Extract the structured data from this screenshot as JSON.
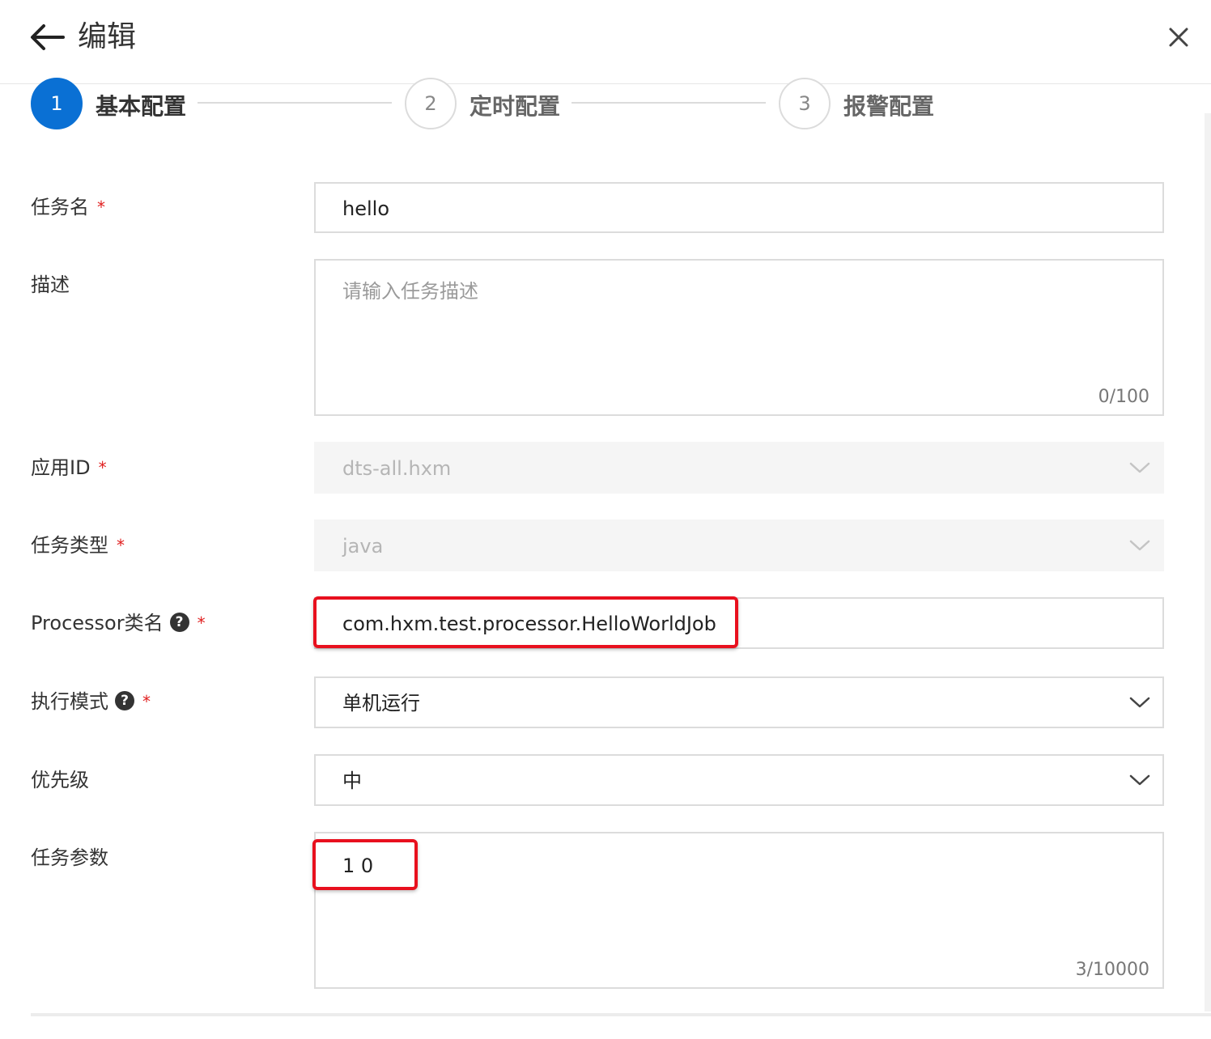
{
  "header": {
    "title": "编辑",
    "back_icon": "arrow-left-icon",
    "close_icon": "close-icon"
  },
  "steps": [
    {
      "number": "1",
      "label": "基本配置",
      "state": "active"
    },
    {
      "number": "2",
      "label": "定时配置",
      "state": "pending"
    },
    {
      "number": "3",
      "label": "报警配置",
      "state": "pending"
    }
  ],
  "form": {
    "task_name": {
      "label": "任务名",
      "required": "*",
      "value": "hello"
    },
    "description": {
      "label": "描述",
      "placeholder": "请输入任务描述",
      "counter": "0/100"
    },
    "app_id": {
      "label": "应用ID",
      "required": "*",
      "value": "dts-all.hxm",
      "disabled": true
    },
    "task_type": {
      "label": "任务类型",
      "required": "*",
      "value": "java",
      "disabled": true
    },
    "processor": {
      "label": "Processor类名",
      "help": "?",
      "required": "*",
      "value": "com.hxm.test.processor.HelloWorldJob"
    },
    "exec_mode": {
      "label": "执行模式",
      "help": "?",
      "required": "*",
      "value": "单机运行"
    },
    "priority": {
      "label": "优先级",
      "value": "中"
    },
    "task_params": {
      "label": "任务参数",
      "value": "1 0",
      "counter": "3/10000"
    }
  },
  "colors": {
    "primary": "#0a70d4",
    "required": "#e02020",
    "highlight": "#e8101e"
  }
}
